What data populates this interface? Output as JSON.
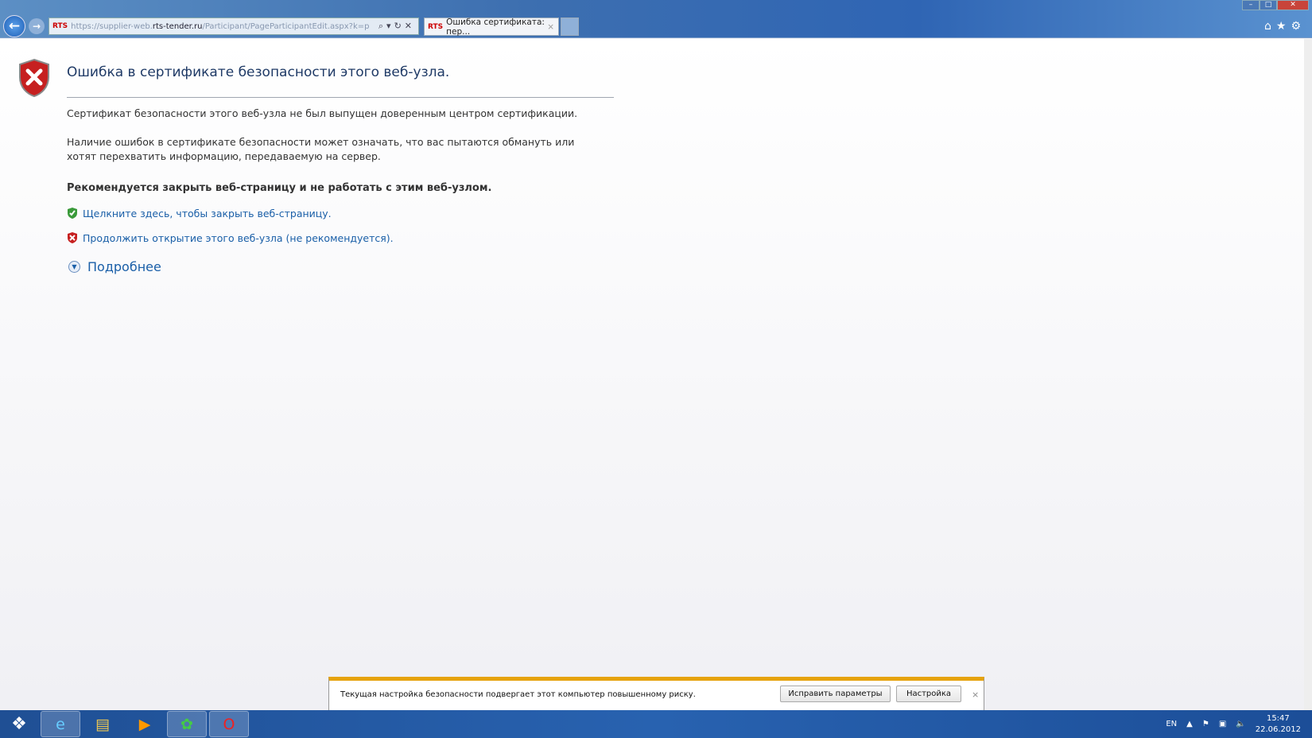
{
  "browser": {
    "address_prefix": "https://supplier-web.",
    "address_domain": "rts-tender.ru",
    "address_path": "/Participant/PageParticipantEdit.aspx?k=p",
    "favicon_text": "RTS",
    "tab_title": "Ошибка сертификата: пер...",
    "tab_close": "×"
  },
  "page": {
    "title": "Ошибка в сертификате безопасности этого веб-узла.",
    "p1": "Сертификат безопасности этого веб-узла не был выпущен доверенным центром сертификации.",
    "p2": "Наличие ошибок в сертификате безопасности может означать, что вас пытаются обмануть или хотят перехватить информацию, передаваемую на сервер.",
    "recommendation": "Рекомендуется закрыть веб-страницу и не работать с этим веб-узлом.",
    "close_link": "Щелкните здесь, чтобы закрыть веб-страницу.",
    "continue_link": "Продолжить открытие этого веб-узла (не рекомендуется).",
    "more_info": "Подробнее"
  },
  "infobar": {
    "message": "Текущая настройка безопасности подвергает этот компьютер повышенному риску.",
    "fix_button": "Исправить параметры",
    "settings_button": "Настройка",
    "close": "×"
  },
  "taskbar": {
    "language": "EN",
    "time": "15:47",
    "date": "22.06.2012"
  }
}
